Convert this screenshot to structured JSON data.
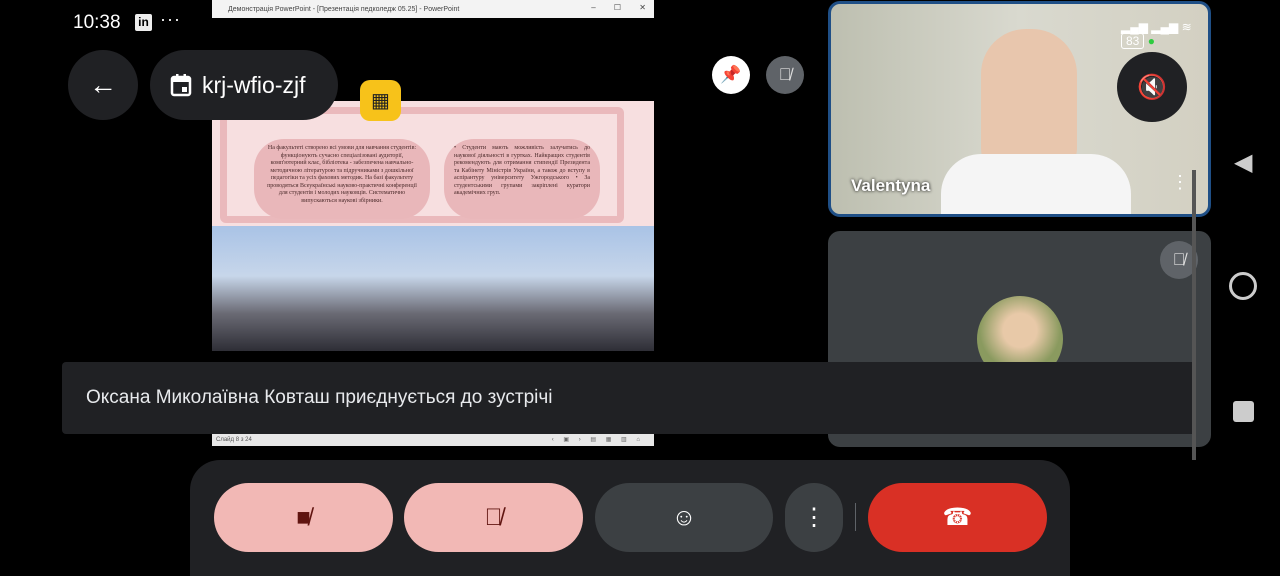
{
  "status": {
    "time": "10:38",
    "battery": "83",
    "linkedin": "in",
    "more": "···"
  },
  "meeting": {
    "code": "krj-wfio-zjf"
  },
  "ppt": {
    "window_title": "Демонстрація PowerPoint - [Презентація педколедж 05.25] - PowerPoint",
    "left_text": "На факультеті створено всі умови для навчання студентів: функціонують сучасно спеціалізовані аудиторії, комп'ютерний клас, бібліотека - забезпечена навчально-методичною літературою та підручниками з дошкільної педагогіки та усіх фахових методик. На базі факультету проводяться Всеукраїнські науково-практичні конференції для студентів і молодих науковців. Систематично випускаються наукові збірники.",
    "right_text": "• Студенти мають можливість залучатись до наукової діяльності в гуртках. Найкращих студентів рекомендують для отримання стипендії Президента та Кабінету Міністрів України, а також до вступу в аспірантуру університету Ужгородського • За студентськими групами закріплені куратори академічних груп.",
    "slide_counter": "Слайд 8 з 24"
  },
  "participants": [
    {
      "name": "Valentyna"
    }
  ],
  "toast": "Оксана Миколаївна Ковташ приєднується до зустрічі",
  "colors": {
    "tile_border": "#1f4f86",
    "end_call": "#d93025",
    "muted_btn": "#f2b8b5",
    "nosh": "#f7c21a"
  }
}
